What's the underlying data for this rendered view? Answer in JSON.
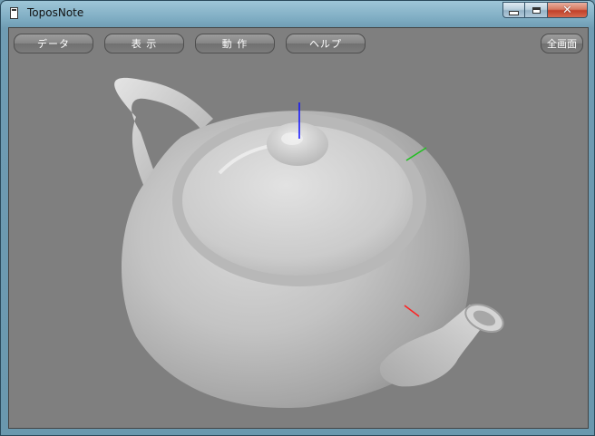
{
  "window": {
    "title": "ToposNote",
    "close_glyph": "✕"
  },
  "toolbar": {
    "data_label": "データ",
    "view_label": "表 示",
    "action_label": "動 作",
    "help_label": "ヘルプ",
    "fullscreen_label": "全画面"
  },
  "viewport": {
    "background": "#7f7f7f",
    "model": "teapot",
    "axis_colors": {
      "x": "#ff2020",
      "y": "#20c020",
      "z": "#1010ff"
    }
  }
}
